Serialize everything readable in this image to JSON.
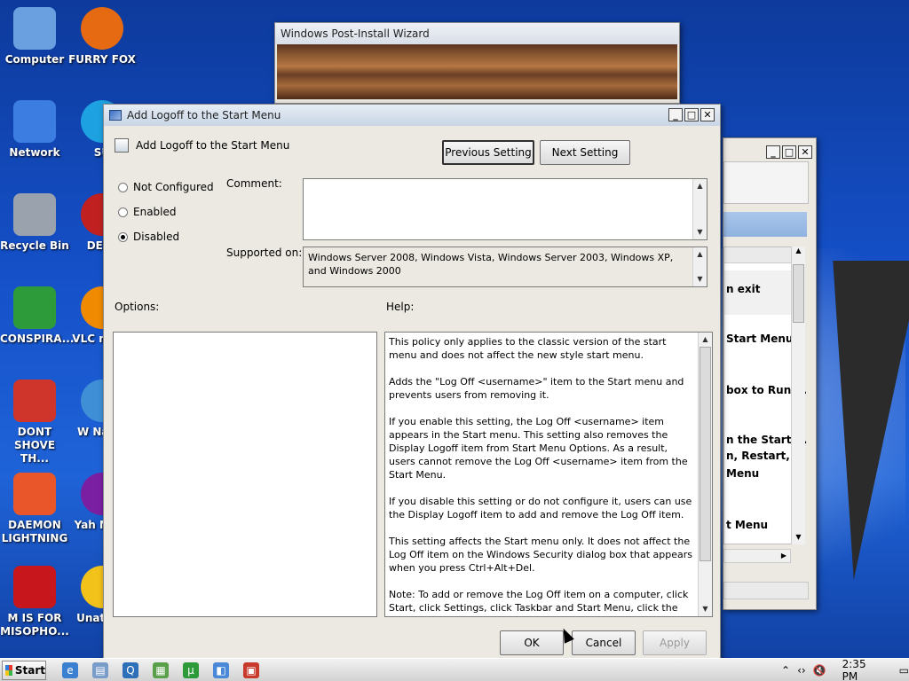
{
  "desktop": {
    "icons": [
      {
        "label": "Computer",
        "icon": "computer-icon",
        "color": "#6aa0e0"
      },
      {
        "label": "Network",
        "icon": "network-icon",
        "color": "#3b7de0"
      },
      {
        "label": "Recycle Bin",
        "icon": "recycle-bin-icon",
        "color": "#9aa3ad"
      },
      {
        "label": "CONSPIRA...",
        "icon": "utorrent-icon",
        "color": "#2e9b3b"
      },
      {
        "label": "DONT SHOVE TH...",
        "icon": "ccleaner-icon",
        "color": "#d0352b"
      },
      {
        "label": "DAEMON LIGHTNING",
        "icon": "daemon-tools-icon",
        "color": "#e8562a"
      },
      {
        "label": "M IS FOR MISOPHO...",
        "icon": "malwarebytes-icon",
        "color": "#c8161d"
      }
    ],
    "icons_col2": [
      {
        "label": "FURRY FOX",
        "icon": "firefox-icon",
        "color": "#e66a12"
      },
      {
        "label": "SU",
        "icon": "skype-icon",
        "color": "#1ea1e0"
      },
      {
        "label": "DEFE",
        "icon": "defender-icon",
        "color": "#c02020"
      },
      {
        "label": "VLC m pla",
        "icon": "vlc-icon",
        "color": "#f08a00"
      },
      {
        "label": "W Navig",
        "icon": "globe-icon",
        "color": "#3e8fd6"
      },
      {
        "label": "Yah Mess",
        "icon": "yahoo-messenger-icon",
        "color": "#7b1fa2"
      },
      {
        "label": "Unatt Sc",
        "icon": "star-icon",
        "color": "#f2c21a"
      }
    ]
  },
  "wizard": {
    "title": "Windows Post-Install Wizard"
  },
  "back_window": {
    "items": [
      "n exit",
      "Start Menu...",
      "box to Run ...",
      "n the Start ...",
      "n, Restart, ...",
      "Menu",
      "t Menu"
    ]
  },
  "dialog": {
    "title": "Add Logoff to the Start Menu",
    "heading": "Add Logoff to the Start Menu",
    "prev_button": "Previous Setting",
    "next_button": "Next Setting",
    "radios": [
      {
        "label": "Not Configured",
        "selected": false
      },
      {
        "label": "Enabled",
        "selected": false
      },
      {
        "label": "Disabled",
        "selected": true
      }
    ],
    "comment_label": "Comment:",
    "comment_value": "",
    "supported_label": "Supported on:",
    "supported_value": "Windows Server 2008, Windows Vista, Windows Server 2003, Windows XP, and Windows 2000",
    "options_label": "Options:",
    "help_label": "Help:",
    "help_paragraphs": [
      "This policy only applies to the classic version of the start menu and does not affect the new style start menu.",
      "Adds the \"Log Off <username>\" item to the Start menu and prevents users from removing it.",
      "If you enable this setting, the Log Off <username> item appears in the Start menu. This setting also removes the Display Logoff item from Start Menu Options. As a result, users cannot remove the Log Off <username> item from the Start Menu.",
      "If you disable this setting or do not configure it, users can use the Display Logoff item to add and remove the Log Off item.",
      "This setting affects the Start menu only. It does not affect the Log Off item on the Windows Security dialog box that appears when you press Ctrl+Alt+Del.",
      "Note: To add or remove the Log Off item on a computer, click Start, click Settings, click Taskbar and Start Menu, click the Start Menu Options tab, and then, in the Start Menu Settings box, click"
    ],
    "ok_button": "OK",
    "cancel_button": "Cancel",
    "apply_button": "Apply"
  },
  "taskbar": {
    "start_label": "Start",
    "clock": "2:35 PM"
  }
}
